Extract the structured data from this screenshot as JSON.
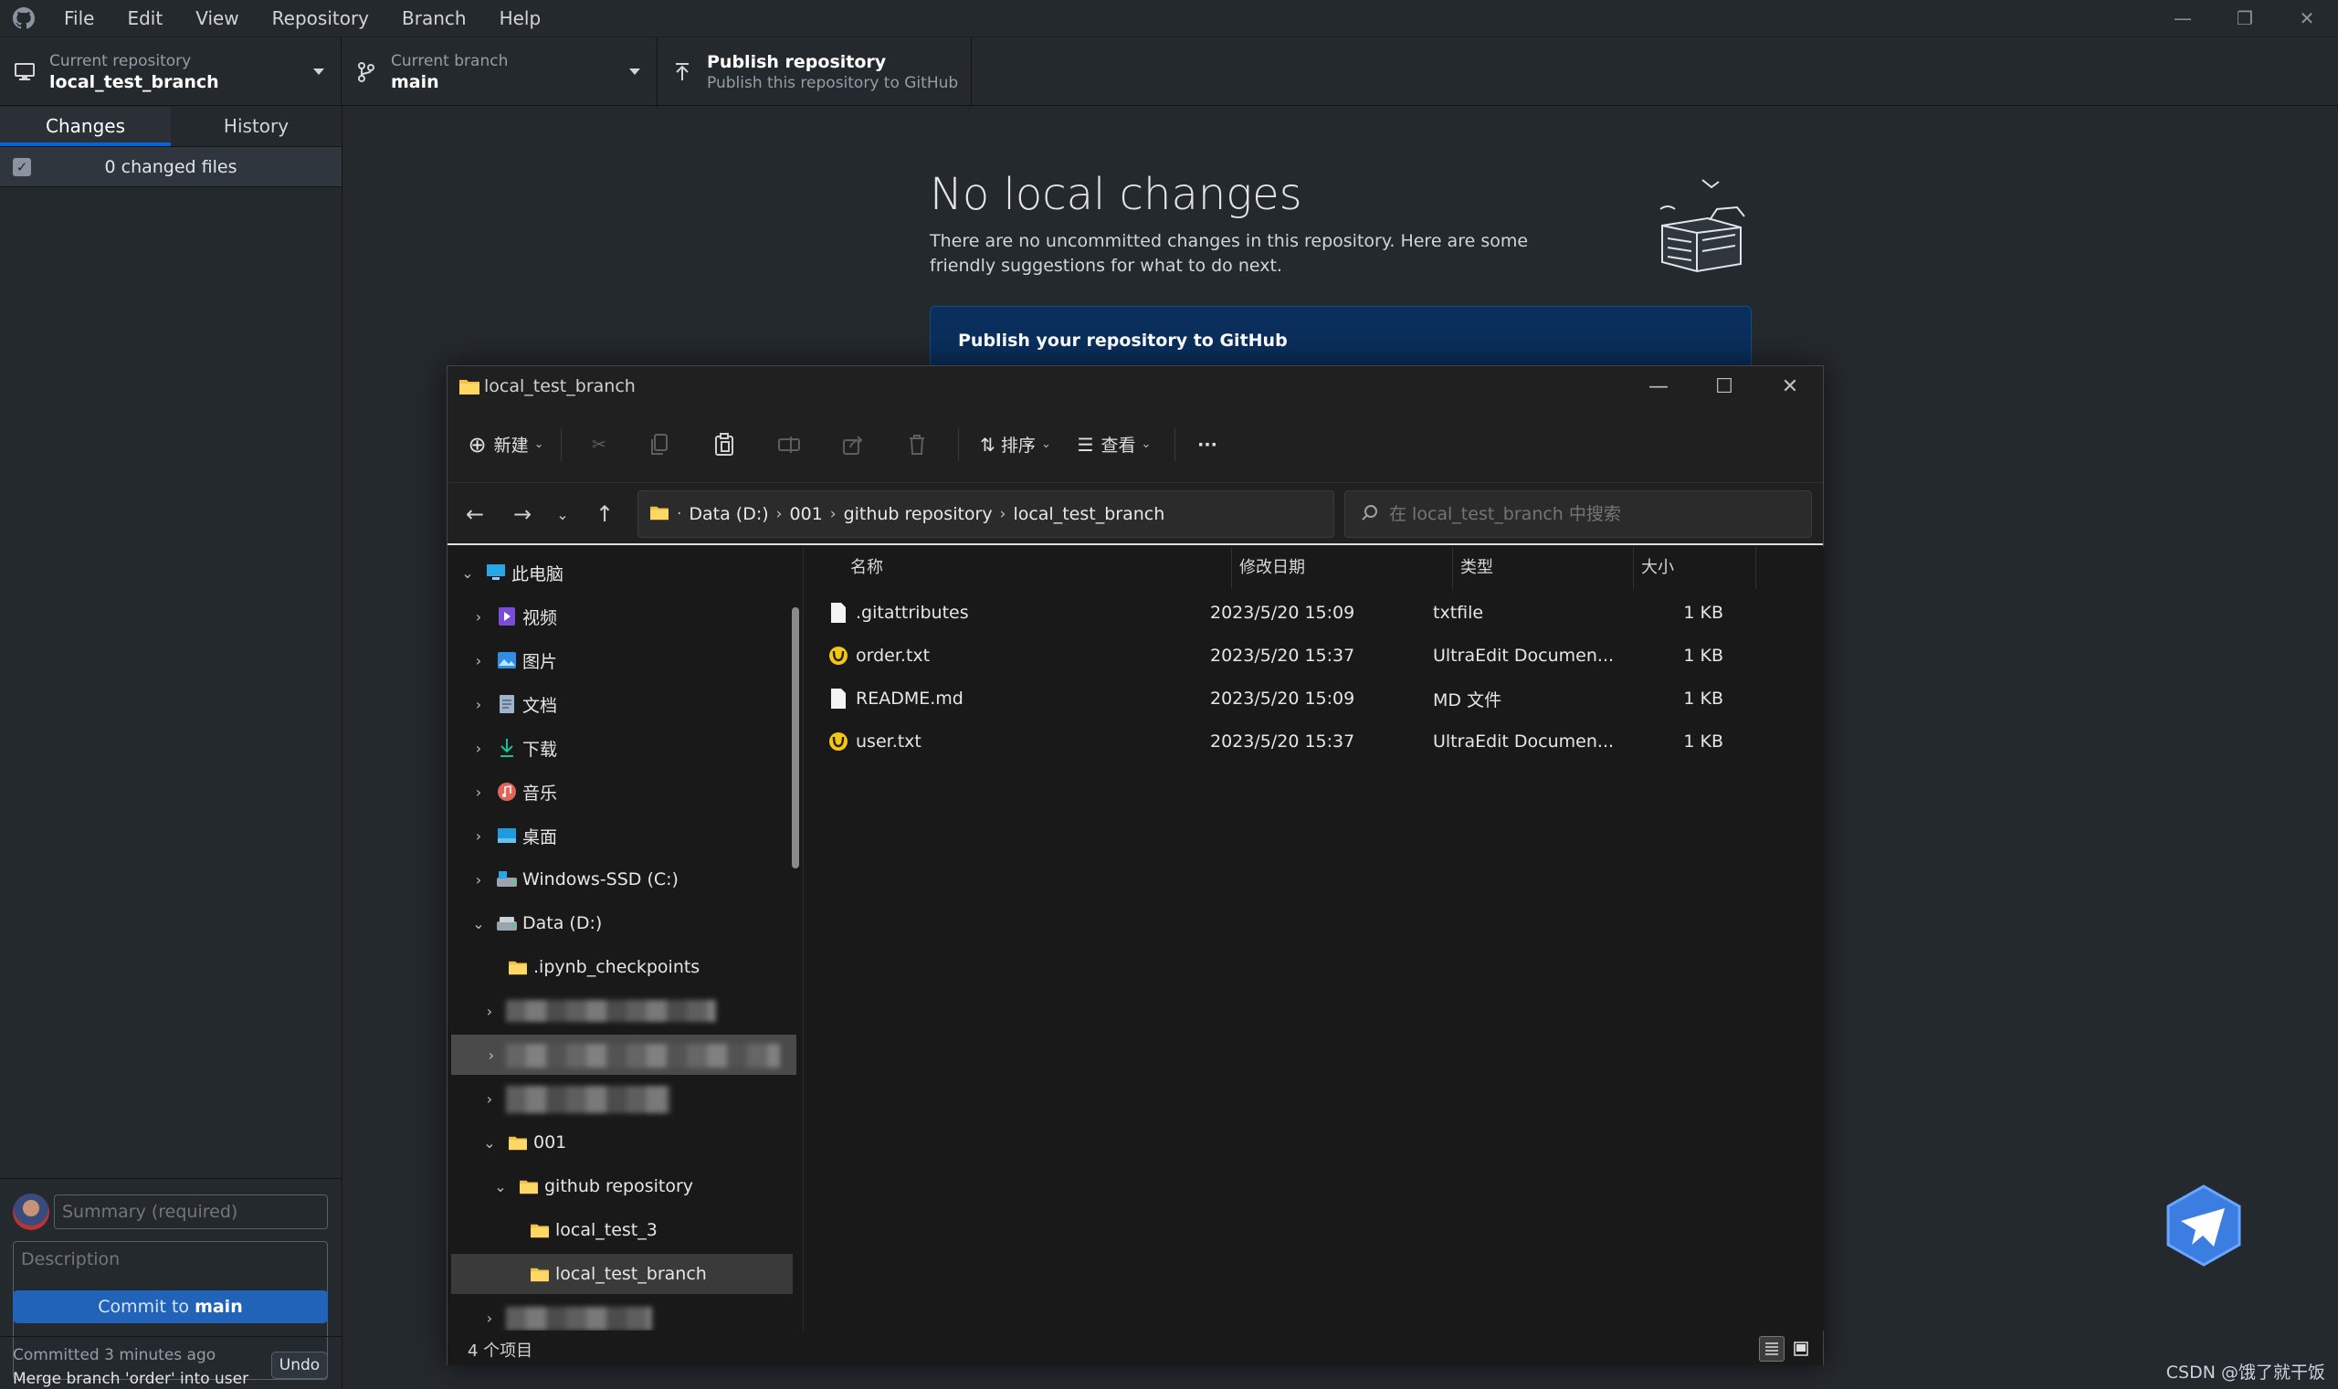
{
  "github_desktop": {
    "menu": [
      "File",
      "Edit",
      "View",
      "Repository",
      "Branch",
      "Help"
    ],
    "current_repository": {
      "label": "Current repository",
      "value": "local_test_branch"
    },
    "current_branch": {
      "label": "Current branch",
      "value": "main"
    },
    "publish": {
      "title": "Publish repository",
      "subtitle": "Publish this repository to GitHub"
    },
    "tabs": {
      "changes": "Changes",
      "history": "History"
    },
    "changed_files": "0 changed files",
    "summary_placeholder": "Summary (required)",
    "description_placeholder": "Description",
    "commit_button": {
      "prefix": "Commit to",
      "branch": "main"
    },
    "last_commit": {
      "time": "Committed 3 minutes ago",
      "message": "Merge branch 'order' into user",
      "undo": "Undo"
    },
    "no_changes": {
      "title": "No local changes",
      "description": "There are no uncommitted changes in this repository. Here are some friendly suggestions for what to do next."
    },
    "publish_card_title": "Publish your repository to GitHub",
    "accent_color": "#0366d6"
  },
  "explorer": {
    "title": "local_test_branch",
    "commands": {
      "new": "新建",
      "sort": "排序",
      "view": "查看",
      "more": "···"
    },
    "breadcrumbs": [
      "Data (D:)",
      "001",
      "github repository",
      "local_test_branch"
    ],
    "search_placeholder": "在 local_test_branch 中搜索",
    "nav_tree": [
      {
        "label": "此电脑",
        "icon": "computer-icon"
      },
      {
        "label": "视频",
        "icon": "videos-icon"
      },
      {
        "label": "图片",
        "icon": "pictures-icon"
      },
      {
        "label": "文档",
        "icon": "documents-icon"
      },
      {
        "label": "下载",
        "icon": "downloads-icon"
      },
      {
        "label": "音乐",
        "icon": "music-icon"
      },
      {
        "label": "桌面",
        "icon": "desktop-icon"
      },
      {
        "label": "Windows-SSD (C:)",
        "icon": "drive-icon"
      },
      {
        "label": "Data (D:)",
        "icon": "drive-icon"
      },
      {
        "label": ".ipynb_checkpoints",
        "icon": "folder-icon"
      },
      {
        "label": "001",
        "icon": "folder-icon"
      },
      {
        "label": "github repository",
        "icon": "folder-icon"
      },
      {
        "label": "local_test_3",
        "icon": "folder-icon"
      },
      {
        "label": "local_test_branch",
        "icon": "folder-icon"
      }
    ],
    "columns": {
      "name": "名称",
      "modified": "修改日期",
      "type": "类型",
      "size": "大小"
    },
    "files": [
      {
        "name": ".gitattributes",
        "modified": "2023/5/20 15:09",
        "type": "txtfile",
        "size": "1 KB",
        "icon": "file-icon"
      },
      {
        "name": "order.txt",
        "modified": "2023/5/20 15:37",
        "type": "UltraEdit Documen...",
        "size": "1 KB",
        "icon": "ultraedit-icon"
      },
      {
        "name": "README.md",
        "modified": "2023/5/20 15:09",
        "type": "MD 文件",
        "size": "1 KB",
        "icon": "file-icon"
      },
      {
        "name": "user.txt",
        "modified": "2023/5/20 15:37",
        "type": "UltraEdit Documen...",
        "size": "1 KB",
        "icon": "ultraedit-icon"
      }
    ],
    "status": "4 个项目"
  },
  "watermark": "CSDN @饿了就干饭"
}
